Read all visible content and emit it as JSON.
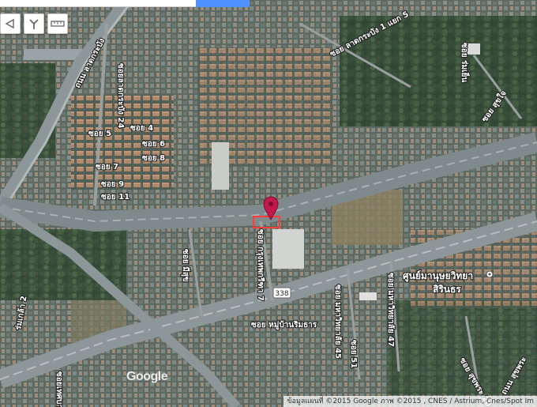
{
  "map": {
    "view": "satellite",
    "colors": {
      "marker": "#c2184b",
      "highlight": "#ff3b3b",
      "expressway": "#7e8a8c",
      "road": "#8d9698",
      "vegetation": "#2f4630"
    },
    "labels": {
      "sukhumvit77": "ถนน ลาดกระบัง",
      "soi_vertical": "ซอยลาดกระบัง 24",
      "soi4": "ซอย 4",
      "soi5": "ซอย 5",
      "soi6": "ซอย 6",
      "soi7": "ซอย 7",
      "soi8": "ซอย 8",
      "soi9": "ซอย 9",
      "soi11": "ซอย 11",
      "soi_top": "ซอย ลาดกระบัง 1 แยก 5",
      "soi_top_right": "ซอย ร่มเย็น",
      "soi_right1": "ซอย สุขใจ",
      "soi_center": "ซอย กรุงเทพกรีฑา 7",
      "soi_center2": "ซอย มีสุข",
      "soi_lower": "ซอย หมู่บ้านริมธาร",
      "soi_45": "ซอย มหาวิทยาลัย 45",
      "soi_47": "ซอย มหาวิทยาลัย 47",
      "soi_51": "ซอย 51",
      "soi_left": "ร่มเกล้า 2",
      "soi_bottom_left": "ซอยเทศบาล",
      "soi_bottom_r1": "ซอย สุขพระ 20",
      "soi_bottom_r2": "ถนน สุขพระ",
      "university": "ศูนย์มานุษยวิทยา",
      "university2": "สิรินธร",
      "route_shield": "338"
    }
  },
  "toolbar": {
    "ruler_icon": "ruler-icon",
    "route_icon": "route-icon",
    "measure_icon": "measure-icon"
  },
  "attribution": "ข้อมูลแผนที่ ©2015 Google ภาพ ©2015 , CNES / Astrium, Cnes/Spot Im",
  "logo": "Google"
}
